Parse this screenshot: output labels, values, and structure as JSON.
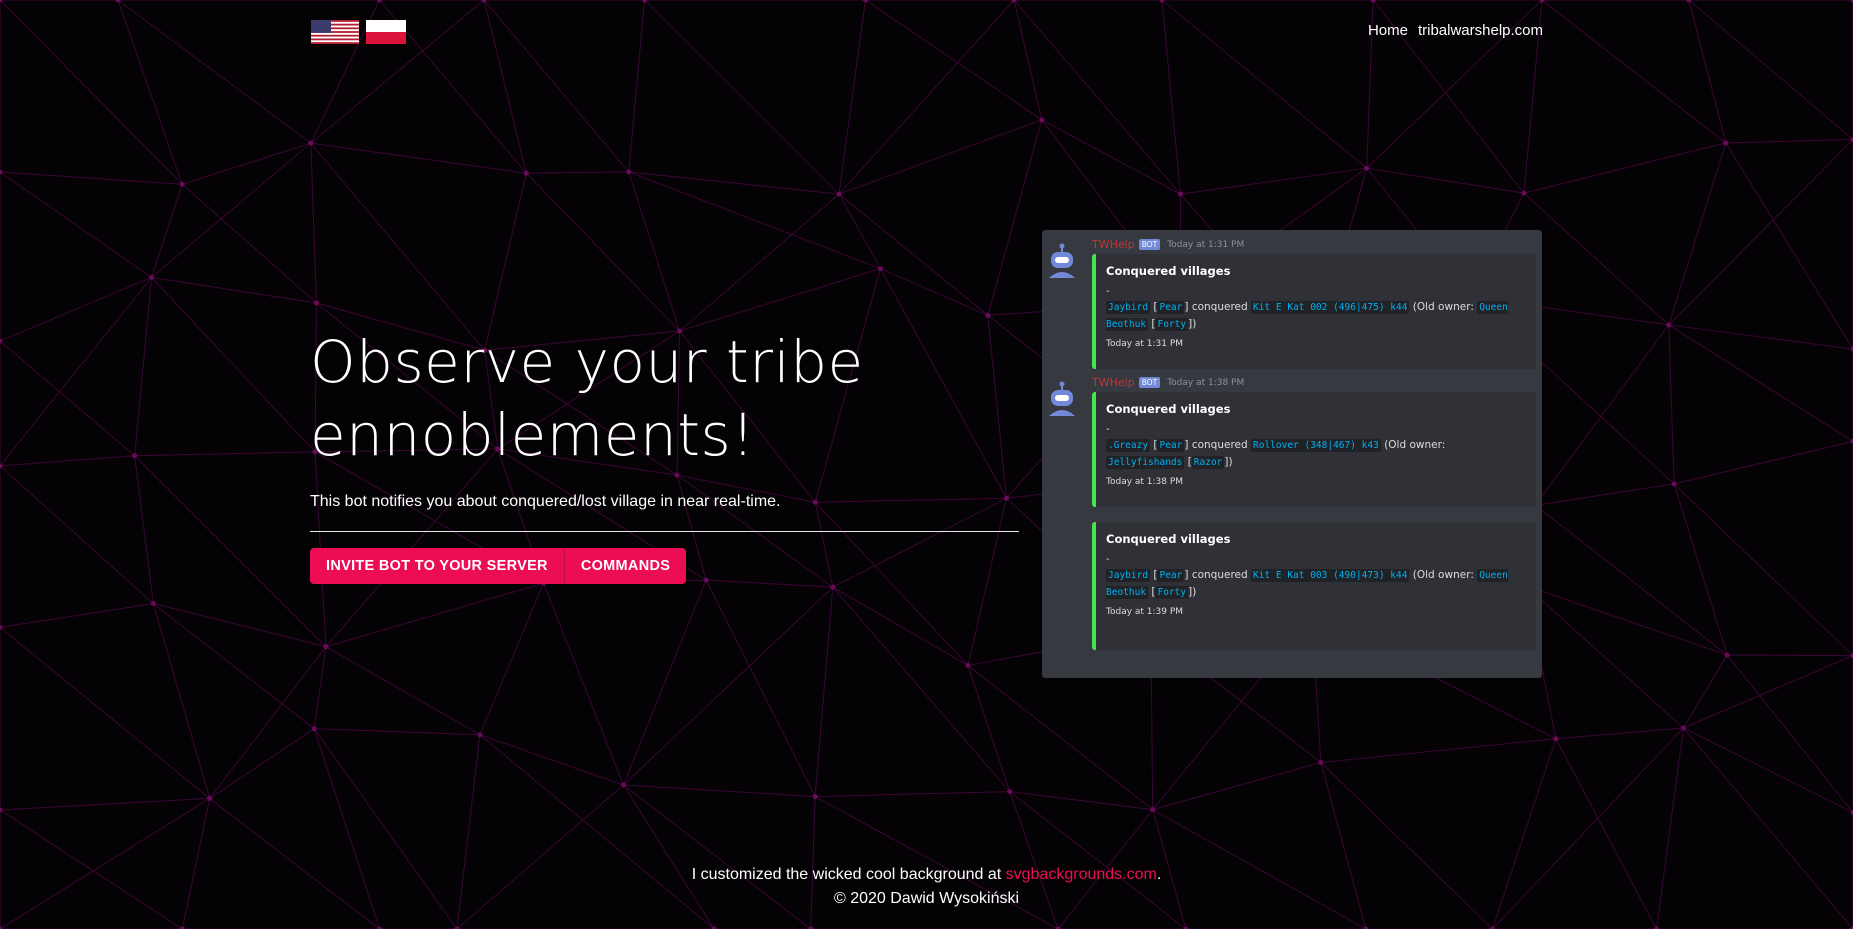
{
  "colors": {
    "background": "#050205",
    "accent": "#ec0d55",
    "lines": "#3a0634",
    "dots": "#6a0a58",
    "embed_border": "#43e54b",
    "bot_name": "#c23636",
    "code_link": "#00b0f4"
  },
  "header": {
    "flags": [
      {
        "name": "us-flag-icon"
      },
      {
        "name": "pl-flag-icon"
      }
    ],
    "nav": [
      {
        "label": "Home"
      },
      {
        "label": "tribalwarshelp.com"
      }
    ]
  },
  "hero": {
    "title_line1": "Observe your tribe",
    "title_line2": "ennoblements!",
    "subtitle": "This bot notifies you about conquered/lost village in near real-time.",
    "buttons": [
      {
        "label": "INVITE BOT TO YOUR SERVER"
      },
      {
        "label": "COMMANDS"
      }
    ]
  },
  "preview": {
    "messages": [
      {
        "author": "TWHelp",
        "badge": "BOT",
        "time": "Today at 1:31 PM",
        "embed": {
          "title": "Conquered villages",
          "dash": "-",
          "player": "Jaybird",
          "player_tribe": "Pear",
          "verb": "conquered",
          "village": "Kit E Kat 002 (496|475) k44",
          "old_owner_label": "(Old owner:",
          "old_owner": "Queen Beothuk",
          "old_owner_tribe": "Forty",
          "close": "])",
          "footer": "Today at 1:31 PM"
        }
      },
      {
        "author": "TWHelp",
        "badge": "BOT",
        "time": "Today at 1:38 PM",
        "embed": {
          "title": "Conquered villages",
          "dash": "-",
          "player": ".Greazy",
          "player_tribe": "Pear",
          "verb": "conquered",
          "village": "Rollover (348|467) k43",
          "old_owner_label": "(Old owner:",
          "old_owner": "Jellyfishands",
          "old_owner_tribe": "Razor",
          "close": "])",
          "footer": "Today at 1:38 PM"
        }
      },
      {
        "embed": {
          "title": "Conquered villages",
          "dash": "-",
          "player": "Jaybird",
          "player_tribe": "Pear",
          "verb": "conquered",
          "village": "Kit E Kat 003 (490|473) k44",
          "old_owner_label": "(Old owner:",
          "old_owner": "Queen Beothuk",
          "old_owner_tribe": "Forty",
          "close": "])",
          "footer": "Today at 1:39 PM"
        }
      }
    ]
  },
  "footer": {
    "credit_prefix": "I customized the wicked cool background at",
    "credit_link": "svgbackgrounds.com",
    "credit_suffix": ".",
    "copyright": "© 2020 Dawid Wysokiński"
  }
}
